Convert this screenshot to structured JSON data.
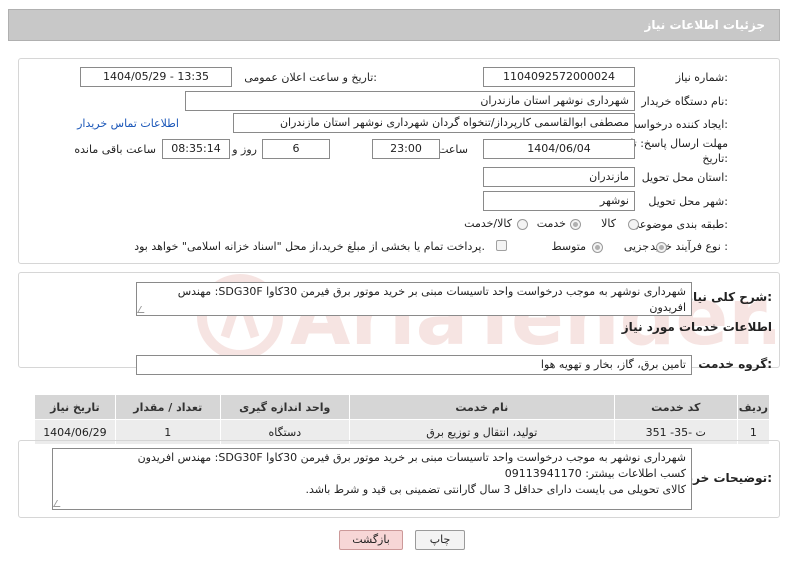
{
  "header": {
    "title": "جزئیات اطلاعات نیاز"
  },
  "fields": {
    "need_number_label": "شماره نیاز:",
    "need_number": "1104092572000024",
    "announce_label": "تاریخ و ساعت اعلان عمومی:",
    "announce_value": "1404/05/29 - 13:35",
    "buyer_org_label": "نام دستگاه خریدار:",
    "buyer_org": "شهرداری نوشهر استان مازندران",
    "creator_label": "ایجاد کننده درخواست:",
    "creator": "مصطفی  ابوالقاسمی کارپرداز/تنخواه گردان شهرداری نوشهر استان مازندران",
    "contact_link": "اطلاعات تماس خریدار",
    "deadline_label_1": "مهلت ارسال پاسخ: تا",
    "deadline_label_2": "تاریخ:",
    "deadline_date": "1404/06/04",
    "time_label": "ساعت",
    "deadline_time": "23:00",
    "days_value": "6",
    "days_label": "روز و",
    "remaining_time": "08:35:14",
    "remaining_label": "ساعت باقی مانده",
    "province_label": "استان محل تحویل:",
    "province": "مازندران",
    "city_label": "شهر محل تحویل:",
    "city": "نوشهر",
    "category_label": "طبقه بندی موضوعی:",
    "category_options": [
      "کالا",
      "خدمت",
      "کالا/خدمت"
    ],
    "category_selected": "خدمت",
    "process_label": "نوع فرآیند خرید :",
    "process_options": [
      "جزیی",
      "متوسط"
    ],
    "process_selected": "جزیی",
    "payment_note": "پرداخت تمام یا بخشی از مبلغ خرید،از محل \"اسناد خزانه اسلامی\" خواهد بود."
  },
  "description": {
    "label": "شرح کلی نیاز:",
    "text": "شهرداری نوشهر به موجب درخواست واحد تاسیسات مبنی بر خرید موتور برق فیرمن 30کاوا SDG30F: مهندس افریدون"
  },
  "services": {
    "section_title": "اطلاعات خدمات مورد نیاز",
    "group_label": "گروه خدمت:",
    "group_value": "تامین برق، گاز، بخار و تهویه هوا",
    "columns": [
      "ردیف",
      "کد خدمت",
      "نام خدمت",
      "واحد اندازه گیری",
      "تعداد / مقدار",
      "تاریخ نیاز"
    ],
    "rows": [
      [
        "1",
        "ت -35- 351",
        "تولید، انتقال و توزیع برق",
        "دستگاه",
        "1",
        "1404/06/29"
      ]
    ]
  },
  "buyer_notes": {
    "label": "توضیحات خریدار:",
    "lines": [
      "شهرداری نوشهر به موجب درخواست واحد تاسیسات مبنی بر خرید موتور برق فیرمن 30کاوا SDG30F: مهندس افریدون",
      "کسب اطلاعات بیشتر: 09113941170",
      "کالای تحویلی می بایست دارای حداقل 3 سال گارانتی تضمینی بی قید و شرط باشد."
    ]
  },
  "buttons": {
    "print": "چاپ",
    "back": "بازگشت"
  },
  "watermark": {
    "text": "AriaTender.neT"
  },
  "colors": {
    "header_bg": "#c8c8c8",
    "link": "#1a56b8",
    "back_button_bg": "#f7d6d6",
    "table_header_bg": "#d6d6d6"
  }
}
